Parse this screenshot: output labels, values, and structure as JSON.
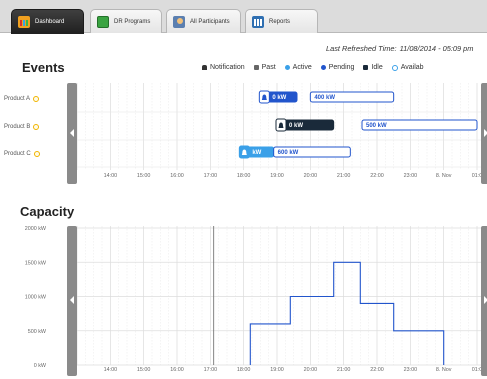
{
  "tabs": [
    {
      "label": "Dashboard",
      "icon": "dashboard-icon",
      "active": true
    },
    {
      "label": "DR Programs",
      "icon": "dr-programs-icon",
      "active": false
    },
    {
      "label": "All Participants",
      "icon": "participants-icon",
      "active": false
    },
    {
      "label": "Reports",
      "icon": "reports-icon",
      "active": false
    }
  ],
  "refresh": {
    "label": "Last Refreshed Time:",
    "value": "11/08/2014 - 05:09 pm"
  },
  "events": {
    "title": "Events",
    "legend": [
      {
        "label": "Notification",
        "color": "#333333",
        "shape": "bell"
      },
      {
        "label": "Past",
        "color": "#666666",
        "shape": "square"
      },
      {
        "label": "Active",
        "color": "#3aa0e8",
        "shape": "square"
      },
      {
        "label": "Pending",
        "color": "#2255cc",
        "shape": "square"
      },
      {
        "label": "Idle",
        "color": "#1a2a3a",
        "shape": "square"
      },
      {
        "label": "Availab",
        "color": "#3aa0e8",
        "shape": "ring"
      }
    ],
    "rows": [
      {
        "label": "Product A"
      },
      {
        "label": "Product B"
      },
      {
        "label": "Product C"
      }
    ],
    "bars": [
      {
        "row": 0,
        "kind": "pending",
        "label": "0 kW",
        "start": 18.5,
        "end": 19.6,
        "notify": true
      },
      {
        "row": 0,
        "kind": "available",
        "label": "400 kW",
        "start": 20.0,
        "end": 22.5
      },
      {
        "row": 1,
        "kind": "idle",
        "label": "0 kW",
        "start": 19.0,
        "end": 20.7,
        "notify": true
      },
      {
        "row": 1,
        "kind": "available",
        "label": "500 kW",
        "start": 21.55,
        "end": 25.0
      },
      {
        "row": 2,
        "kind": "active",
        "label": "kW",
        "start": 17.9,
        "end": 18.9,
        "notify": true
      },
      {
        "row": 2,
        "kind": "available",
        "label": "600 kW",
        "start": 18.9,
        "end": 21.2
      }
    ]
  },
  "x_ticks": [
    "14:00",
    "15:00",
    "16:00",
    "17:00",
    "18:00",
    "19:00",
    "20:00",
    "21:00",
    "22:00",
    "23:00",
    "8. Nov",
    "01:0"
  ],
  "capacity": {
    "title": "Capacity"
  },
  "chart_data": {
    "type": "line",
    "title": "Capacity",
    "step": true,
    "x_ticks": [
      "14:00",
      "15:00",
      "16:00",
      "17:00",
      "18:00",
      "19:00",
      "20:00",
      "21:00",
      "22:00",
      "23:00",
      "8. Nov",
      "01:0"
    ],
    "y_ticks": [
      "0 kW",
      "500 kW",
      "1000 kW",
      "1500 kW",
      "2000 kW"
    ],
    "ylim": [
      0,
      2000
    ],
    "xlim": [
      13.0,
      25.3
    ],
    "current_time": 17.1,
    "series": [
      {
        "color": "#2255cc",
        "x": [
          18.2,
          18.2,
          19.4,
          19.4,
          20.7,
          20.7,
          21.5,
          21.5,
          22.5,
          22.5,
          24.0,
          24.0
        ],
        "y": [
          0,
          600,
          600,
          1000,
          1000,
          1500,
          1500,
          900,
          900,
          500,
          500,
          0
        ]
      }
    ]
  }
}
